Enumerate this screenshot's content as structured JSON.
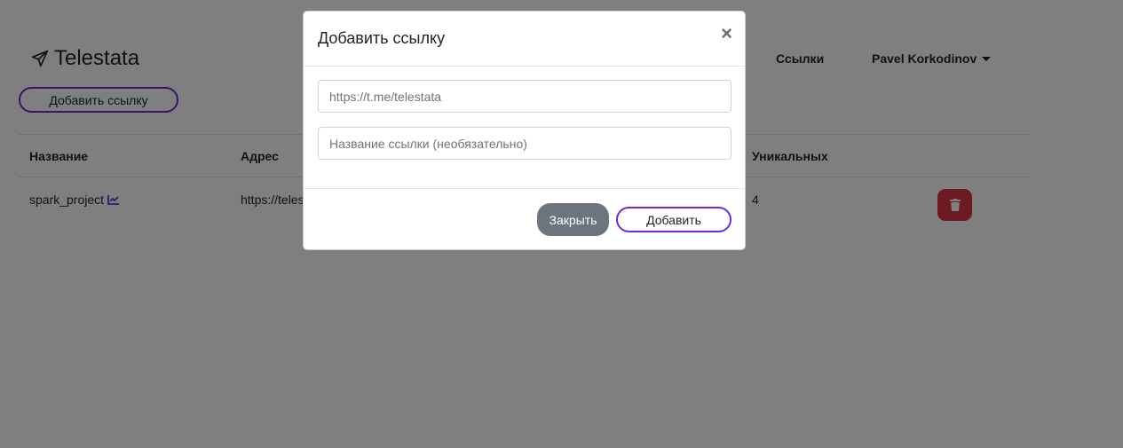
{
  "brand": {
    "name": "Telestata",
    "icon": "paper-plane-icon"
  },
  "nav": {
    "links_label": "Ссылки",
    "user_name": "Pavel Korkodinov"
  },
  "toolbar": {
    "add_link_label": "Добавить ссылку"
  },
  "table": {
    "headers": {
      "name": "Название",
      "address": "Адрес",
      "unique": "Уникальных"
    },
    "rows": [
      {
        "name": "spark_project",
        "address": "https://teles",
        "unique": "4"
      }
    ]
  },
  "modal": {
    "title": "Добавить ссылку",
    "close_symbol": "×",
    "url_placeholder": "https://t.me/telestata",
    "name_placeholder": "Название ссылки (необязательно)",
    "close_label": "Закрыть",
    "add_label": "Добавить"
  },
  "colors": {
    "accent": "#6f2bd6",
    "danger": "#dc3545",
    "secondary": "#6c757d"
  }
}
